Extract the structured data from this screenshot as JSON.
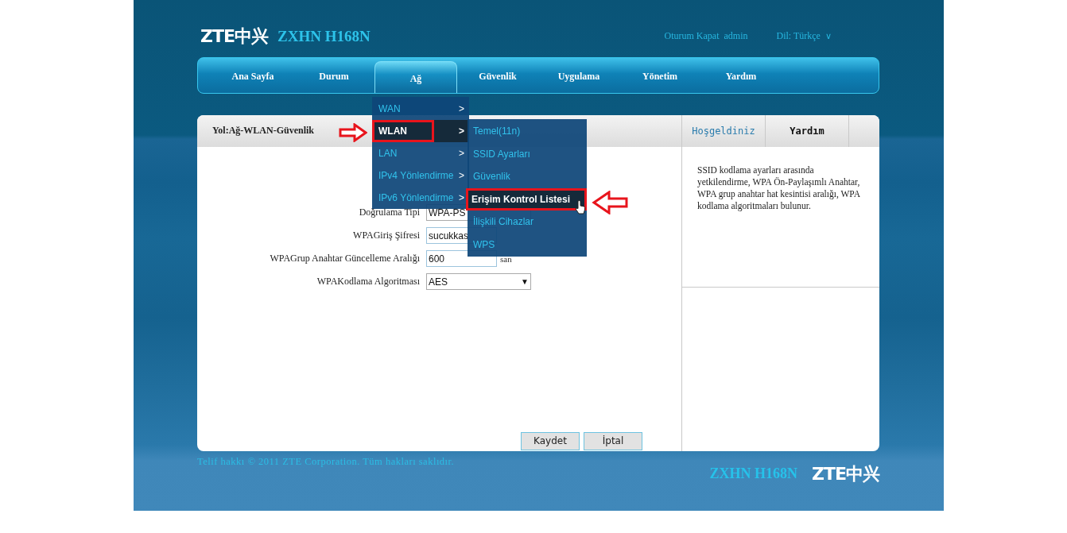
{
  "header": {
    "logo": "ZTE中兴",
    "model": "ZXHN H168N",
    "logout": "Oturum Kapat",
    "user": "admin",
    "language": "Dil: Türkçe",
    "language_caret": "∨"
  },
  "nav": [
    {
      "label": "Ana Sayfa",
      "selected": false
    },
    {
      "label": "Durum",
      "selected": false
    },
    {
      "label": "Ağ",
      "selected": true
    },
    {
      "label": "Güvenlik",
      "selected": false
    },
    {
      "label": "Uygulama",
      "selected": false
    },
    {
      "label": "Yönetim",
      "selected": false
    },
    {
      "label": "Yardım",
      "selected": false
    }
  ],
  "menu": [
    {
      "label": "WAN",
      "arrow": ">",
      "selected": false
    },
    {
      "label": "WLAN",
      "arrow": ">",
      "selected": true
    },
    {
      "label": "LAN",
      "arrow": ">",
      "selected": false
    },
    {
      "label": "IPv4 Yönlendirme",
      "arrow": ">",
      "selected": false
    },
    {
      "label": "IPv6 Yönlendirme",
      "arrow": ">",
      "selected": false
    }
  ],
  "submenu": [
    {
      "label": "Temel(11n)",
      "selected": false
    },
    {
      "label": "SSID Ayarları",
      "selected": false
    },
    {
      "label": "Güvenlik",
      "selected": false
    },
    {
      "label": "Erişim Kontrol Listesi",
      "selected": true
    },
    {
      "label": "İlişkili Cihazlar",
      "selected": false
    },
    {
      "label": "WPS",
      "selected": false
    }
  ],
  "breadcrumb": "Yol:Ağ-WLAN-Güvenlik",
  "form": [
    {
      "label": "Doğrulama Tipi",
      "kind": "select",
      "value": "WPA-PS"
    },
    {
      "label": "WPAGiriş Şifresi",
      "kind": "input",
      "value": "sucukkas"
    },
    {
      "label": "WPAGrup Anahtar Güncelleme Aralığı",
      "kind": "input",
      "value": "600",
      "unit": "san"
    },
    {
      "label": "WPAKodlama Algoritması",
      "kind": "select",
      "value": "AES",
      "caret": "▼"
    }
  ],
  "buttons": [
    "Kaydet",
    "İptal"
  ],
  "help_tabs": [
    {
      "label": "Hoşgeldiniz",
      "selected": false
    },
    {
      "label": "Yardım",
      "selected": true
    }
  ],
  "help_text": "SSID kodlama ayarları arasında yetkilendirme, WPA Ön-Paylaşımlı Anahtar, WPA grup anahtar hat kesintisi aralığı, WPA kodlama algoritmaları bulunur.",
  "footer": {
    "copyright": "Telif hakkı © 2011 ZTE Corporation. Tüm hakları saklıdır.",
    "model": "ZXHN H168N",
    "logo": "ZTE中兴"
  }
}
